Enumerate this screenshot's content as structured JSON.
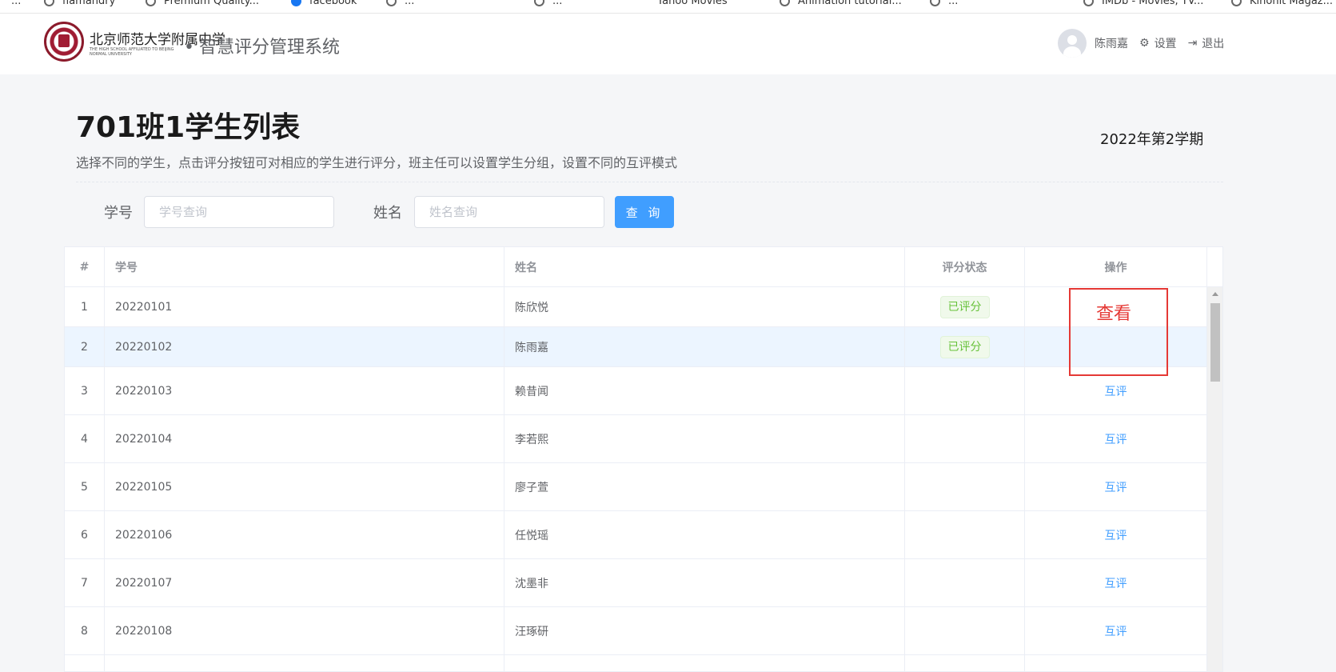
{
  "bookmarks": [
    {
      "label": "...",
      "icon": "globe-icon"
    },
    {
      "label": "flamandry",
      "icon": "globe-icon"
    },
    {
      "label": "Premium Quality...",
      "icon": "globe-icon"
    },
    {
      "label": "facebook",
      "icon": "facebook-icon"
    },
    {
      "label": "...",
      "icon": "globe-icon"
    },
    {
      "label": "...",
      "icon": "globe-icon"
    },
    {
      "label": "Yahoo Movies",
      "icon": "globe-icon"
    },
    {
      "label": "Animation tutorial...",
      "icon": "globe-icon"
    },
    {
      "label": "...",
      "icon": "globe-icon"
    },
    {
      "label": "IMDb - Movies, TV...",
      "icon": "globe-icon"
    },
    {
      "label": "Kinohit Magaz...",
      "icon": "globe-icon"
    }
  ],
  "header": {
    "logo_text": "北京师范大学附属中学",
    "logo_sub": "THE HIGH SCHOOL AFFILIATED TO BEIJING NORMAL UNIVERSITY",
    "app_title": "智慧评分管理系统",
    "user_name": "陈雨嘉",
    "settings_label": "设置",
    "logout_label": "退出"
  },
  "page": {
    "title": "701班1学生列表",
    "description": "选择不同的学生，点击评分按钮可对相应的学生进行评分，班主任可以设置学生分组，设置不同的互评模式",
    "term": "2022年第2学期"
  },
  "search": {
    "student_no_label": "学号",
    "student_no_placeholder": "学号查询",
    "student_no_value": "",
    "name_label": "姓名",
    "name_placeholder": "姓名查询",
    "name_value": "",
    "query_button": "查 询"
  },
  "table": {
    "columns": [
      "#",
      "学号",
      "姓名",
      "评分状态",
      "操作"
    ],
    "rows": [
      {
        "idx": "1",
        "no": "20220101",
        "name": "陈欣悦",
        "status": "已评分",
        "action": ""
      },
      {
        "idx": "2",
        "no": "20220102",
        "name": "陈雨嘉",
        "status": "已评分",
        "action": ""
      },
      {
        "idx": "3",
        "no": "20220103",
        "name": "赖昔闻",
        "status": "",
        "action": "互评"
      },
      {
        "idx": "4",
        "no": "20220104",
        "name": "李若熙",
        "status": "",
        "action": "互评"
      },
      {
        "idx": "5",
        "no": "20220105",
        "name": "廖子萱",
        "status": "",
        "action": "互评"
      },
      {
        "idx": "6",
        "no": "20220106",
        "name": "任悦瑶",
        "status": "",
        "action": "互评"
      },
      {
        "idx": "7",
        "no": "20220107",
        "name": "沈墨非",
        "status": "",
        "action": "互评"
      },
      {
        "idx": "8",
        "no": "20220108",
        "name": "汪琢研",
        "status": "",
        "action": "互评"
      }
    ]
  },
  "annotation": {
    "text": "查看",
    "color": "#e53935"
  },
  "colors": {
    "primary": "#409eff",
    "success": "#67c23a",
    "selected_row": "#ecf5ff"
  }
}
